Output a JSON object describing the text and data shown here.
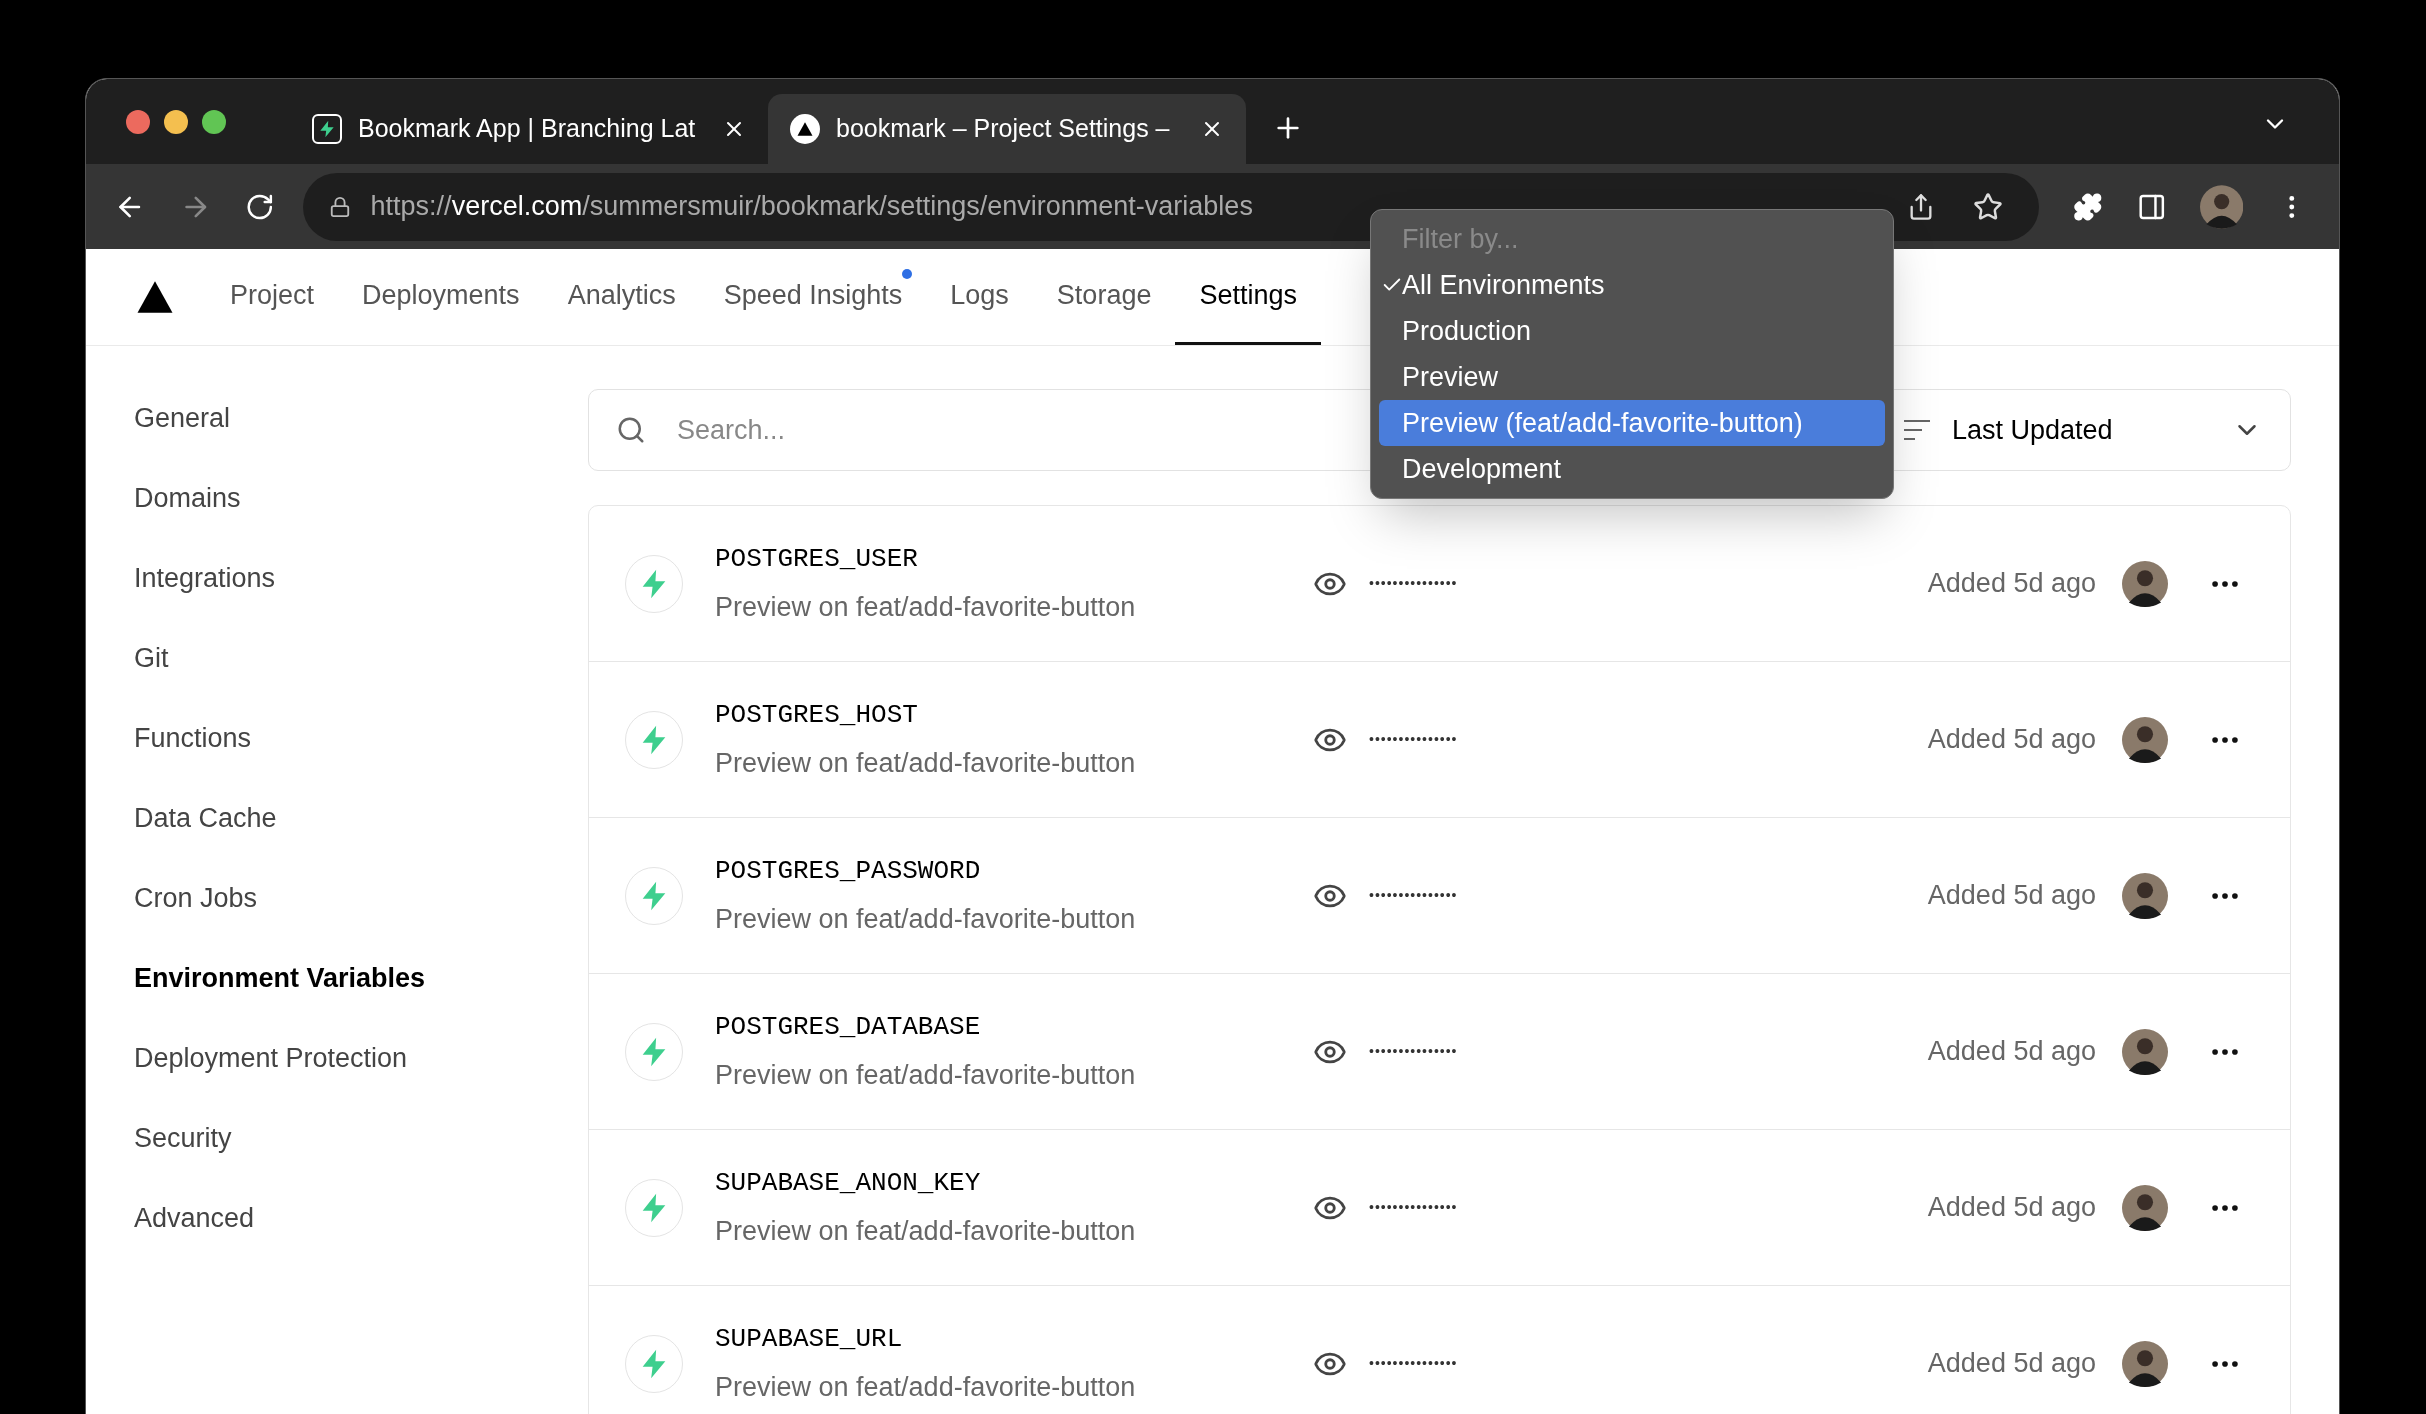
{
  "browser": {
    "tabs": [
      {
        "title": "Bookmark App | Branching Lat",
        "kind": "bolt",
        "selected": false
      },
      {
        "title": "bookmark – Project Settings –",
        "kind": "triangle",
        "selected": true
      }
    ],
    "url": {
      "scheme": "https://",
      "host": "vercel.com",
      "path": "/summersmuir/bookmark/settings/environment-variables"
    }
  },
  "nav": [
    {
      "label": "Project",
      "selected": false,
      "dot": false
    },
    {
      "label": "Deployments",
      "selected": false,
      "dot": false
    },
    {
      "label": "Analytics",
      "selected": false,
      "dot": false
    },
    {
      "label": "Speed Insights",
      "selected": false,
      "dot": true
    },
    {
      "label": "Logs",
      "selected": false,
      "dot": false
    },
    {
      "label": "Storage",
      "selected": false,
      "dot": false
    },
    {
      "label": "Settings",
      "selected": true,
      "dot": false
    }
  ],
  "sidebar": [
    {
      "label": "General",
      "selected": false
    },
    {
      "label": "Domains",
      "selected": false
    },
    {
      "label": "Integrations",
      "selected": false
    },
    {
      "label": "Git",
      "selected": false
    },
    {
      "label": "Functions",
      "selected": false
    },
    {
      "label": "Data Cache",
      "selected": false
    },
    {
      "label": "Cron Jobs",
      "selected": false
    },
    {
      "label": "Environment Variables",
      "selected": true
    },
    {
      "label": "Deployment Protection",
      "selected": false
    },
    {
      "label": "Security",
      "selected": false
    },
    {
      "label": "Advanced",
      "selected": false
    }
  ],
  "search": {
    "placeholder": "Search..."
  },
  "sort": {
    "value": "Last Updated"
  },
  "filter_menu": {
    "title": "Filter by...",
    "items": [
      {
        "label": "All Environments",
        "checked": true,
        "selected": false
      },
      {
        "label": "Production",
        "checked": false,
        "selected": false
      },
      {
        "label": "Preview",
        "checked": false,
        "selected": false
      },
      {
        "label": "Preview (feat/add-favorite-button)",
        "checked": false,
        "selected": true
      },
      {
        "label": "Development",
        "checked": false,
        "selected": false
      }
    ]
  },
  "variables": [
    {
      "name": "POSTGRES_USER",
      "scope": "Preview on feat/add-favorite-button",
      "value": "•••••••••••••••",
      "added": "Added 5d ago"
    },
    {
      "name": "POSTGRES_HOST",
      "scope": "Preview on feat/add-favorite-button",
      "value": "•••••••••••••••",
      "added": "Added 5d ago"
    },
    {
      "name": "POSTGRES_PASSWORD",
      "scope": "Preview on feat/add-favorite-button",
      "value": "•••••••••••••••",
      "added": "Added 5d ago"
    },
    {
      "name": "POSTGRES_DATABASE",
      "scope": "Preview on feat/add-favorite-button",
      "value": "•••••••••••••••",
      "added": "Added 5d ago"
    },
    {
      "name": "SUPABASE_ANON_KEY",
      "scope": "Preview on feat/add-favorite-button",
      "value": "•••••••••••••••",
      "added": "Added 5d ago"
    },
    {
      "name": "SUPABASE_URL",
      "scope": "Preview on feat/add-favorite-button",
      "value": "•••••••••••••••",
      "added": "Added 5d ago"
    }
  ]
}
